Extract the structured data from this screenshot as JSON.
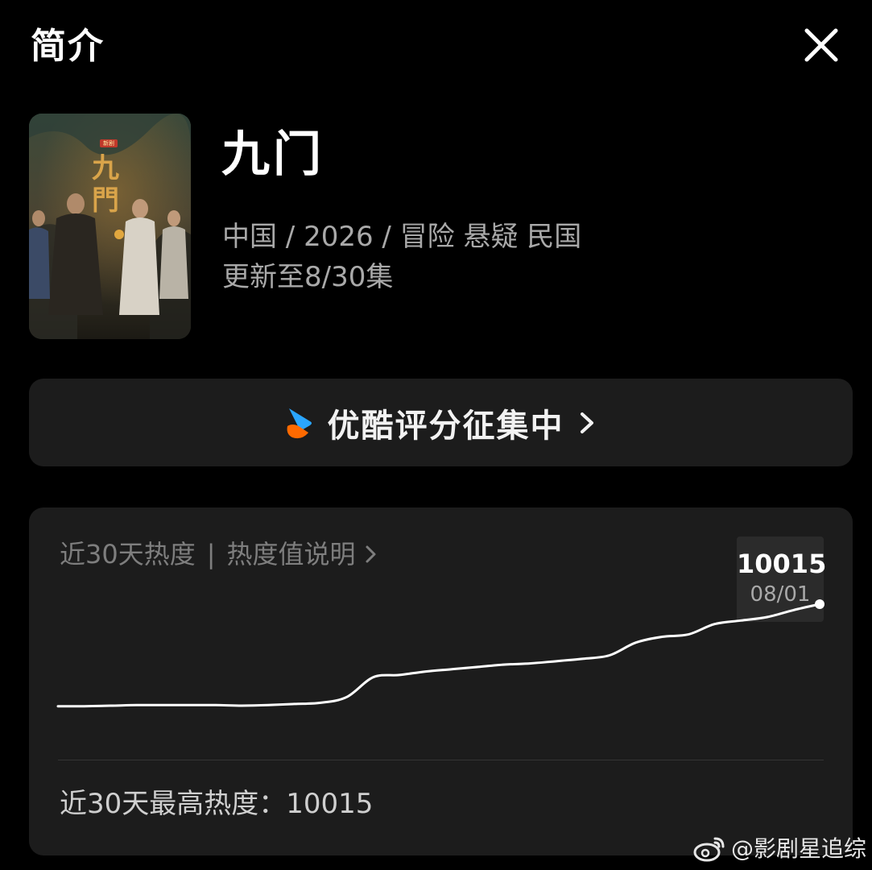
{
  "header": {
    "title": "简介",
    "close_icon": "close-icon"
  },
  "show": {
    "poster_icon": "poster-image",
    "poster_text": "九門",
    "poster_badge": "新剧",
    "title": "九门",
    "meta": "中国 / 2026 / 冒险 悬疑 民国",
    "episodes": "更新至8/30集"
  },
  "rating": {
    "label": "优酷评分征集中",
    "logo_icon": "youku-logo-icon",
    "chevron_icon": "chevron-right-icon",
    "logo_colors": [
      "#2aa6ff",
      "#ff6a00"
    ]
  },
  "heat": {
    "title": "近30天热度",
    "separator": "|",
    "explain_link": "热度值说明",
    "tooltip_value": "10015",
    "tooltip_date": "08/01",
    "footer": "近30天最高热度：10015",
    "line_color": "#ffffff"
  },
  "chart_data": {
    "type": "line",
    "x": [
      1,
      2,
      3,
      4,
      5,
      6,
      7,
      8,
      9,
      10,
      11,
      12,
      13,
      14,
      15,
      16,
      17,
      18,
      19,
      20,
      21,
      22,
      23,
      24,
      25,
      26,
      27,
      28,
      29,
      30
    ],
    "series": [
      {
        "values": [
          1200,
          1200,
          1250,
          1300,
          1300,
          1300,
          1300,
          1250,
          1300,
          1400,
          1500,
          2000,
          3700,
          3900,
          4200,
          4400,
          4600,
          4800,
          4900,
          5100,
          5300,
          5600,
          6700,
          7200,
          7400,
          8300,
          8600,
          8900,
          9500,
          10015
        ]
      }
    ],
    "annotations": [
      {
        "label": "10015",
        "date": "08/01"
      }
    ],
    "grid": false,
    "legend": "none"
  },
  "watermark": {
    "icon": "weibo-icon",
    "text": "@影剧星追综"
  }
}
